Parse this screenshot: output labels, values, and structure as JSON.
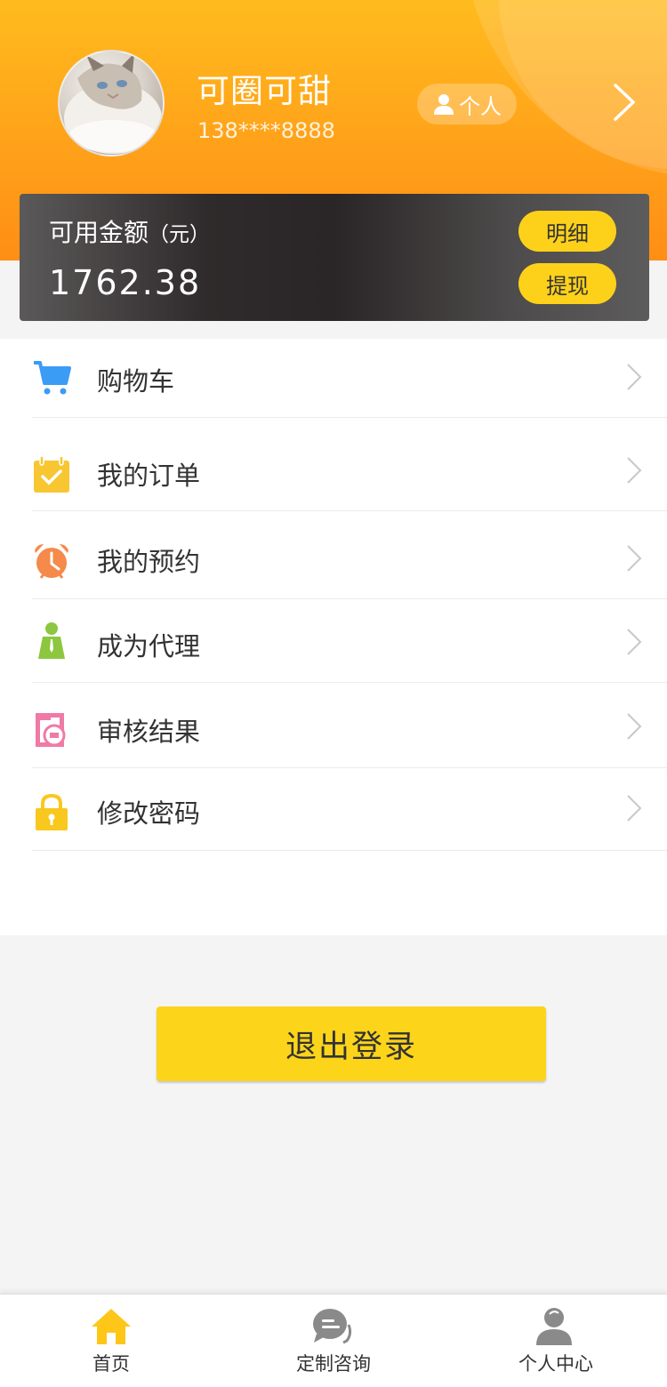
{
  "profile": {
    "name": "可圈可甜",
    "phone": "138****8888",
    "tag_label": "个人"
  },
  "balance": {
    "label": "可用金额",
    "unit": "（元）",
    "value": "1762.38",
    "detail_button": "明细",
    "withdraw_button": "提现"
  },
  "menu": {
    "items": [
      {
        "label": "购物车",
        "icon": "cart-icon",
        "color": "#3b9cf6"
      },
      {
        "label": "我的订单",
        "icon": "calendar-check-icon",
        "color": "#f7c631"
      },
      {
        "label": "我的预约",
        "icon": "alarm-clock-icon",
        "color": "#f58a4b"
      },
      {
        "label": "成为代理",
        "icon": "agent-person-icon",
        "color": "#8dc63f"
      },
      {
        "label": "审核结果",
        "icon": "review-result-icon",
        "color": "#f07aa6"
      },
      {
        "label": "修改密码",
        "icon": "lock-icon",
        "color": "#f9c81e"
      }
    ]
  },
  "logout": {
    "label": "退出登录"
  },
  "tabbar": {
    "tabs": [
      {
        "label": "首页",
        "icon": "home-icon",
        "color": "#ffc61a"
      },
      {
        "label": "定制咨询",
        "icon": "chat-bubble-icon",
        "color": "#8a8a8a"
      },
      {
        "label": "个人中心",
        "icon": "user-icon",
        "color": "#8a8a8a"
      }
    ]
  },
  "colors": {
    "header_gradient_top": "#ffbb1d",
    "header_gradient_bottom": "#ff8e15",
    "accent_yellow": "#fdd11a",
    "card_dark": "#2a2526"
  }
}
